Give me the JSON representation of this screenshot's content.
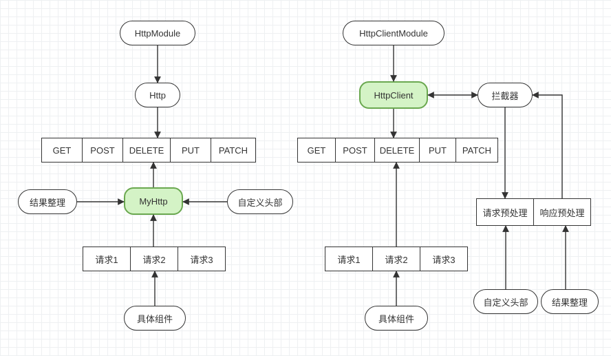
{
  "diagram": {
    "left": {
      "httpModule": "HttpModule",
      "http": "Http",
      "methods": [
        "GET",
        "POST",
        "DELETE",
        "PUT",
        "PATCH"
      ],
      "resultTidy": "结果整理",
      "myHttp": "MyHttp",
      "customHeader": "自定义头部",
      "requests": [
        "请求1",
        "请求2",
        "请求3"
      ],
      "concreteComponent": "具体组件"
    },
    "right": {
      "httpClientModule": "HttpClientModule",
      "httpClient": "HttpClient",
      "interceptor": "拦截器",
      "methods": [
        "GET",
        "POST",
        "DELETE",
        "PUT",
        "PATCH"
      ],
      "requests": [
        "请求1",
        "请求2",
        "请求3"
      ],
      "concreteComponent": "具体组件",
      "requestPre": "请求预处理",
      "responsePre": "响应预处理",
      "customHeader": "自定义头部",
      "resultTidy": "结果整理"
    }
  }
}
